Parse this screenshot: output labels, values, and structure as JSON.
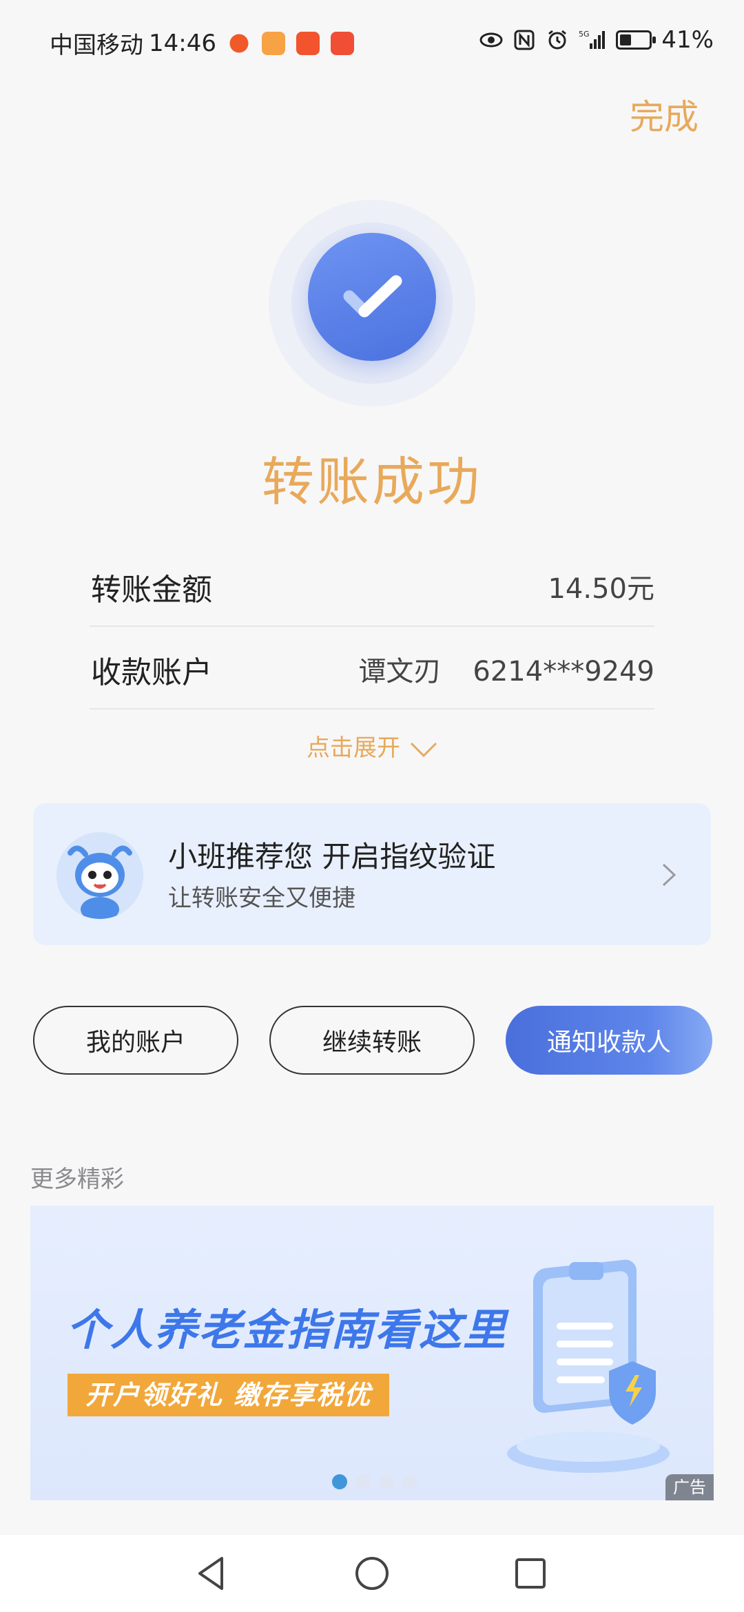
{
  "status_bar": {
    "carrier": "中国移动",
    "time": "14:46",
    "battery_text": "41%",
    "battery_level": 0.41,
    "signal_label": "5G"
  },
  "header": {
    "done_label": "完成"
  },
  "result": {
    "title": "转账成功"
  },
  "details": {
    "amount_label": "转账金额",
    "amount_value": "14.50元",
    "payee_label": "收款账户",
    "payee_name": "谭文刃",
    "payee_account": "6214***9249",
    "expand_label": "点击展开"
  },
  "fingerprint_card": {
    "title": "小班推荐您 开启指纹验证",
    "subtitle": "让转账安全又便捷"
  },
  "actions": {
    "my_account": "我的账户",
    "continue_transfer": "继续转账",
    "notify_payee": "通知收款人"
  },
  "more": {
    "label": "更多精彩"
  },
  "banner": {
    "headline": "个人养老金指南看这里",
    "tagline": "开户领好礼 缴存享税优",
    "ad_label": "广告",
    "slide_count": 4,
    "active_slide": 1
  },
  "colors": {
    "accent_gold": "#e8a95a",
    "primary_blue": "#4b71df",
    "banner_blue": "#3d77ea",
    "tag_orange": "#f2a73a"
  }
}
